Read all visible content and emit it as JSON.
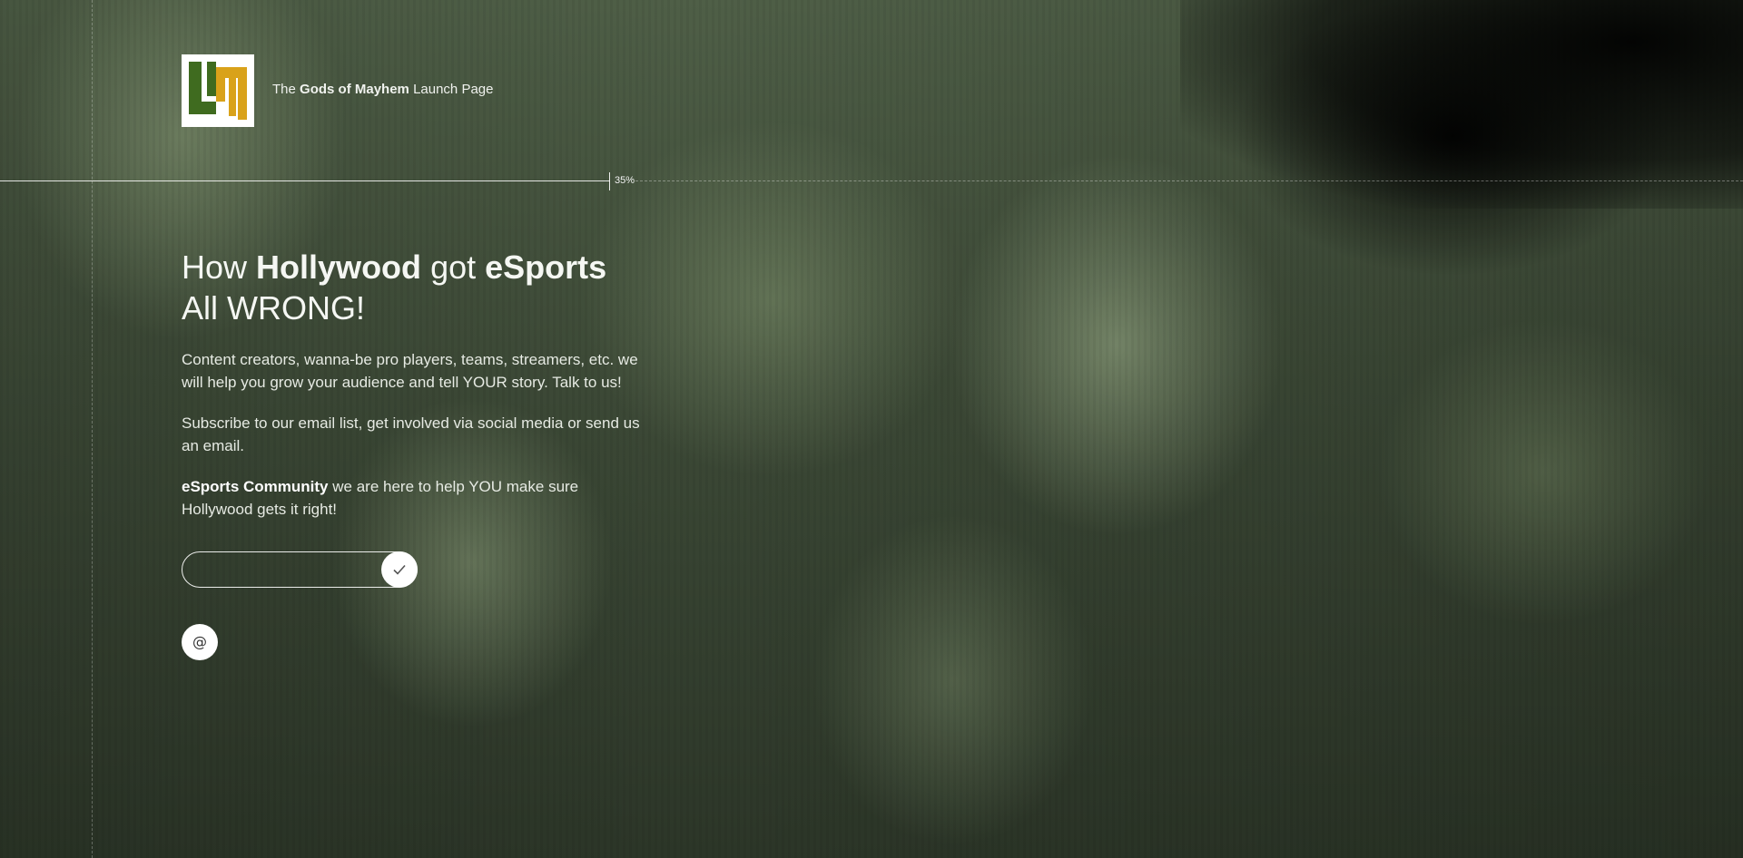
{
  "brand": {
    "prefix": "The",
    "name": "Gods of Mayhem",
    "suffix": "Launch Page",
    "logo_icon": "gods-of-mayhem-logo",
    "logo_colors": [
      "#3f6b1f",
      "#d9a21a",
      "#ffffff"
    ]
  },
  "progress": {
    "value": 0.35,
    "label": "35%"
  },
  "headline": {
    "part1": "How",
    "bold1": "Hollywood",
    "part2": "got",
    "bold2": "eSports",
    "line2": "All WRONG!"
  },
  "paragraphs": {
    "p1": "Content creators, wanna-be pro players, teams, streamers, etc. we will help you grow your audience and tell YOUR story. Talk to us!",
    "p2": "Subscribe to our email list, get involved via social media or send us an email.",
    "p3_bold": "eSports Community",
    "p3_rest": " we are here to help YOU make sure Hollywood gets it right!"
  },
  "subscribe": {
    "value": "",
    "placeholder": "",
    "submit_icon": "checkmark-icon"
  },
  "contact": {
    "email_icon": "at-sign-icon",
    "email_glyph": "@"
  }
}
